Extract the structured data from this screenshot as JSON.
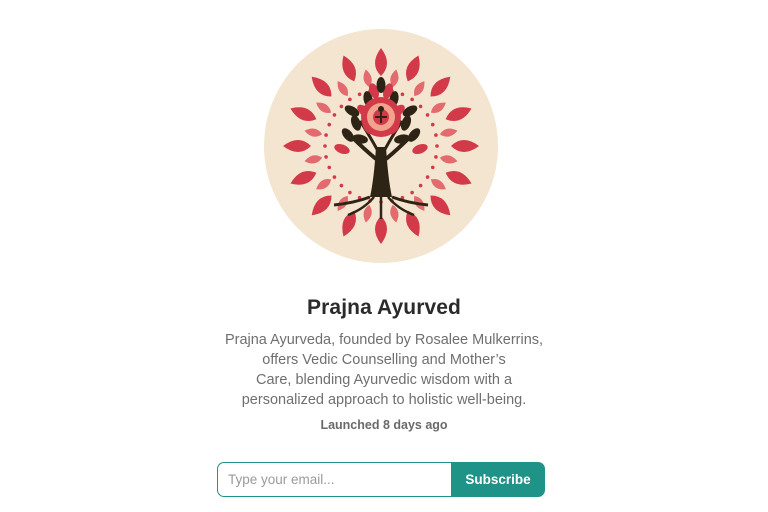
{
  "profile": {
    "name": "Prajna Ayurved",
    "description_lines": [
      "Prajna Ayurveda, founded by Rosalee Mulkerrins,",
      "offers Vedic Counselling and Mother’s",
      "Care, blending Ayurvedic wisdom with a",
      "personalized approach to holistic well-being."
    ],
    "launched": "Launched 8 days ago",
    "logo_icon": "tree-of-life-logo"
  },
  "subscribe": {
    "placeholder": "Type your email...",
    "value": "",
    "button_label": "Subscribe"
  },
  "colors": {
    "logo_background": "#f3e5cf",
    "petal_red": "#d23a4a",
    "tree_brown": "#2e2416",
    "accent_teal": "#1f9388"
  }
}
